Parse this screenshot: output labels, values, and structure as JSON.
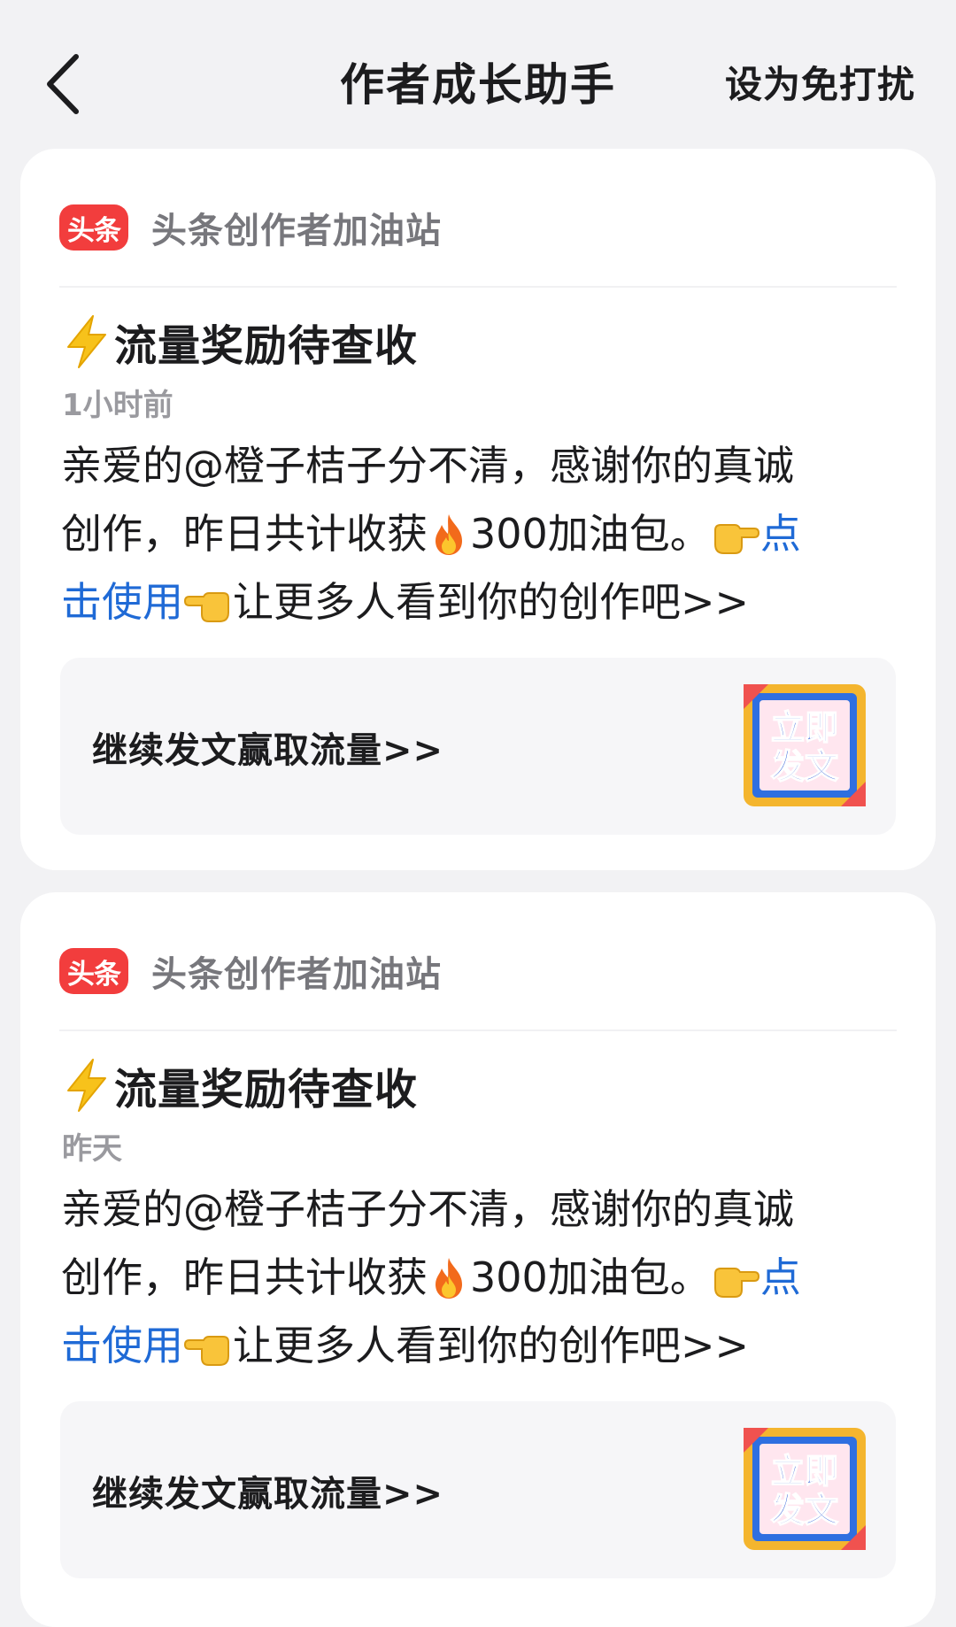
{
  "header": {
    "title": "作者成长助手",
    "dnd_label": "设为免打扰"
  },
  "colors": {
    "background": "#f2f2f4",
    "card": "#ffffff",
    "link": "#1f6ad6",
    "logo_red": "#f23d3d",
    "muted_text": "#9a9a9f"
  },
  "messages": [
    {
      "source_logo": "头条",
      "source_name": "头条创作者加油站",
      "title_icon": "lightning-icon",
      "title": "流量奖励待查收",
      "time": "1小时前",
      "body": {
        "line1": "亲爱的@橙子桔子分不清，感谢你的真诚",
        "line2_a": "创作，昨日共计收获",
        "fire_icon": "fire-icon",
        "line2_b": "300加油包。",
        "pointing_icon": "pointing-right-icon",
        "link_a": "点",
        "link_b": "击使用",
        "line3": "让更多人看到你的创作吧>>"
      },
      "cta_text": "继续发文赢取流量>>",
      "cta_badge": "立即发文",
      "cta_badge_line1": "立即",
      "cta_badge_line2": "发文"
    },
    {
      "source_logo": "头条",
      "source_name": "头条创作者加油站",
      "title_icon": "lightning-icon",
      "title": "流量奖励待查收",
      "time": "昨天",
      "body": {
        "line1": "亲爱的@橙子桔子分不清，感谢你的真诚",
        "line2_a": "创作，昨日共计收获",
        "fire_icon": "fire-icon",
        "line2_b": "300加油包。",
        "pointing_icon": "pointing-right-icon",
        "link_a": "点",
        "link_b": "击使用",
        "line3": "让更多人看到你的创作吧>>"
      },
      "cta_text": "继续发文赢取流量>>",
      "cta_badge": "立即发文",
      "cta_badge_line1": "立即",
      "cta_badge_line2": "发文"
    }
  ]
}
